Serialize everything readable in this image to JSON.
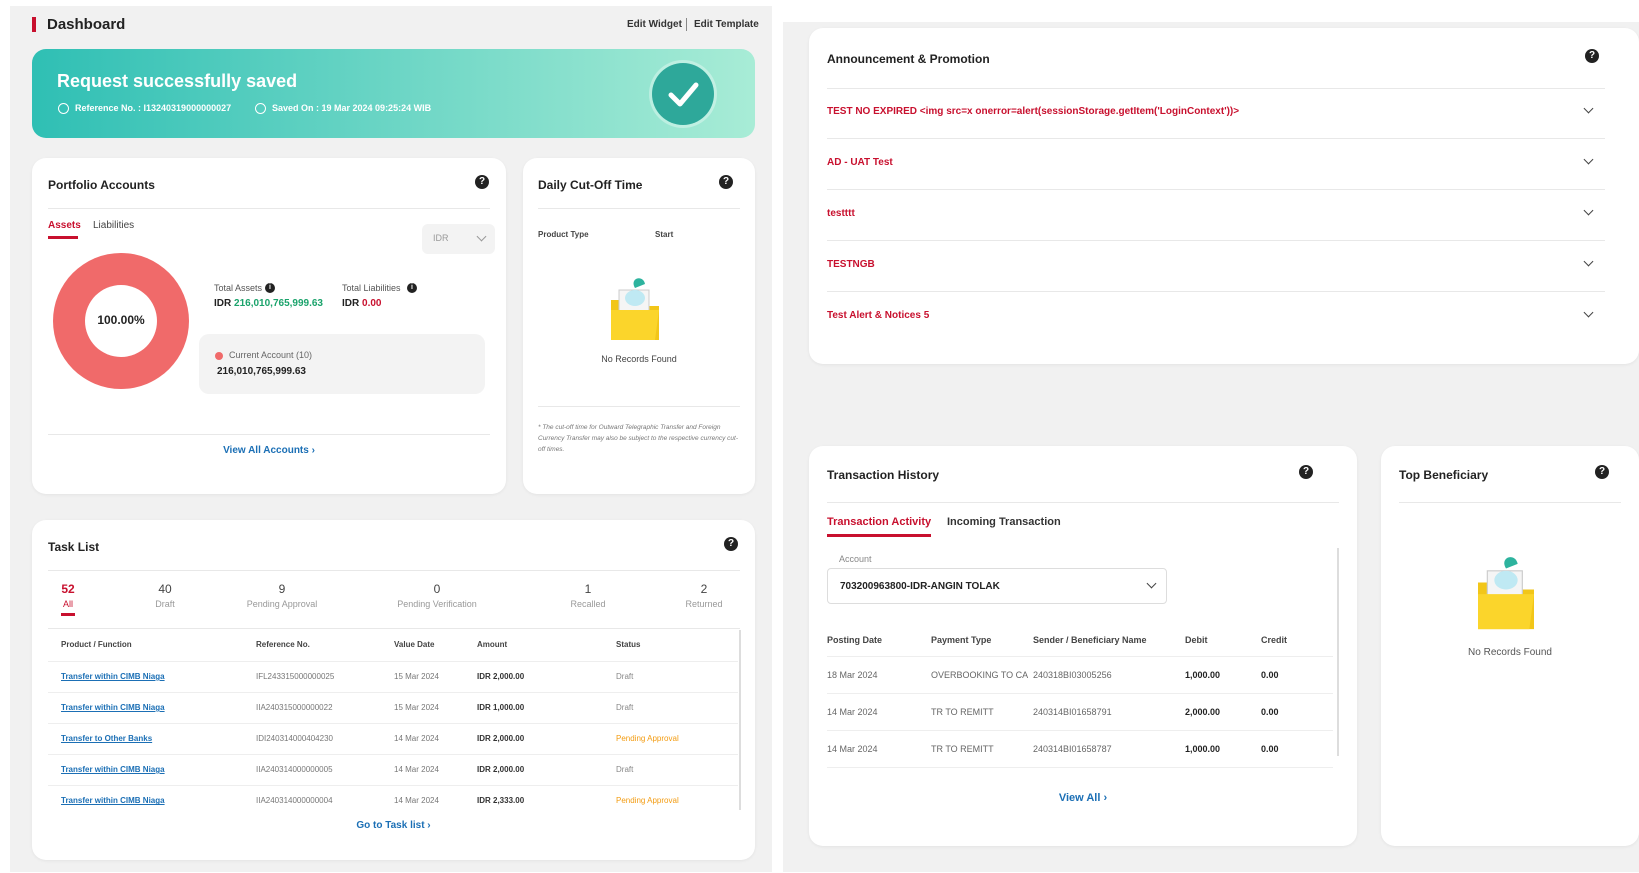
{
  "header": {
    "title": "Dashboard",
    "edit_widget": "Edit Widget",
    "edit_template": "Edit Template"
  },
  "banner": {
    "title": "Request successfully saved",
    "reference_label": "Reference No. : I13240319000000027",
    "saved_label": "Saved On : 19 Mar 2024 09:25:24 WIB"
  },
  "portfolio": {
    "title": "Portfolio Accounts",
    "tabs": [
      "Assets",
      "Liabilities"
    ],
    "currency": "IDR",
    "donut_label": "100.00%",
    "total_assets_label": "Total Assets",
    "total_assets_currency": "IDR",
    "total_assets_value": "216,010,765,999.63",
    "total_liabilities_label": "Total Liabilities",
    "total_liabilities_currency": "IDR",
    "total_liabilities_value": "0.00",
    "account_name": "Current Account (10)",
    "account_value": "216,010,765,999.63",
    "view_all": "View All Accounts ›"
  },
  "cutoff": {
    "title": "Daily Cut-Off Time",
    "col_product": "Product Type",
    "col_start": "Start",
    "empty": "No Records Found",
    "note": "* The cut-off time for Outward Telegraphic Transfer and Foreign Currency Transfer may also be subject to the respective currency cut-off times."
  },
  "tasks": {
    "title": "Task List",
    "counts": [
      {
        "value": "52",
        "label": "All"
      },
      {
        "value": "40",
        "label": "Draft"
      },
      {
        "value": "9",
        "label": "Pending Approval"
      },
      {
        "value": "0",
        "label": "Pending Verification"
      },
      {
        "value": "1",
        "label": "Recalled"
      },
      {
        "value": "2",
        "label": "Returned"
      }
    ],
    "columns": [
      "Product / Function",
      "Reference No.",
      "Value Date",
      "Amount",
      "Status"
    ],
    "rows": [
      [
        "Transfer within CIMB Niaga",
        "IFL243315000000025",
        "15 Mar 2024",
        "IDR 2,000.00",
        "Draft"
      ],
      [
        "Transfer within CIMB Niaga",
        "IIA240315000000022",
        "15 Mar 2024",
        "IDR 1,000.00",
        "Draft"
      ],
      [
        "Transfer to Other Banks",
        "IDI240314000404230",
        "14 Mar 2024",
        "IDR 2,000.00",
        "Pending Approval"
      ],
      [
        "Transfer within CIMB Niaga",
        "IIA240314000000005",
        "14 Mar 2024",
        "IDR 2,000.00",
        "Draft"
      ],
      [
        "Transfer within CIMB Niaga",
        "IIA240314000000004",
        "14 Mar 2024",
        "IDR 2,333.00",
        "Pending Approval"
      ]
    ],
    "footer": "Go to Task list ›"
  },
  "announcements": {
    "title": "Announcement & Promotion",
    "items": [
      "TEST NO EXPIRED <img src=x onerror=alert(sessionStorage.getItem('LoginContext'))>",
      "AD - UAT Test",
      "testttt",
      "TESTNGB",
      "Test Alert & Notices 5"
    ]
  },
  "history": {
    "title": "Transaction History",
    "tabs": [
      "Transaction Activity",
      "Incoming Transaction"
    ],
    "account_label": "Account",
    "account_value": "703200963800-IDR-ANGIN TOLAK",
    "columns": [
      "Posting Date",
      "Payment Type",
      "Sender / Beneficiary Name",
      "Debit",
      "Credit"
    ],
    "rows": [
      [
        "18 Mar 2024",
        "OVERBOOKING TO CA",
        "240318BI03005256",
        "1,000.00",
        "0.00"
      ],
      [
        "14 Mar 2024",
        "TR TO REMITT",
        "240314BI01658791",
        "2,000.00",
        "0.00"
      ],
      [
        "14 Mar 2024",
        "TR TO REMITT",
        "240314BI01658787",
        "1,000.00",
        "0.00"
      ]
    ],
    "view_all": "View All ›"
  },
  "beneficiary": {
    "title": "Top Beneficiary",
    "empty": "No Records Found"
  },
  "colors": {
    "accent_red": "#c8102e",
    "banner_start": "#2fbfb4",
    "banner_end": "#a8ecd6",
    "donut": "#f06a6a",
    "positive_green": "#1aa36b",
    "link_blue": "#1b6fb5",
    "pending_orange": "#f39c12"
  }
}
